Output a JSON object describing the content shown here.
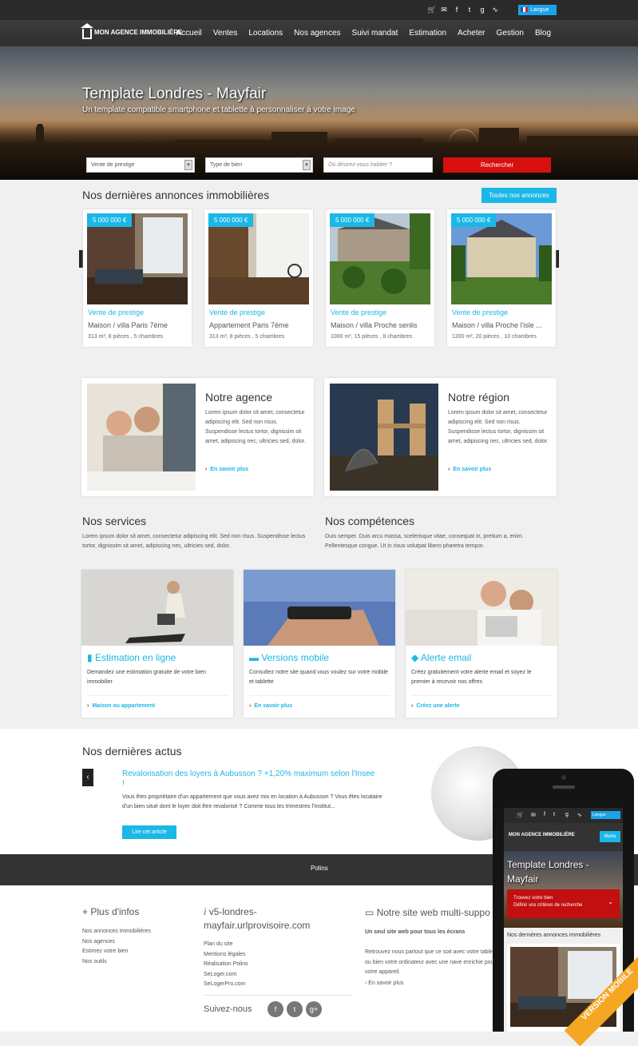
{
  "topbar": {
    "icons": [
      "cart-icon",
      "mail-icon",
      "facebook-icon",
      "twitter-icon",
      "google-plus-icon",
      "rss-icon"
    ],
    "lang_label": "Langue"
  },
  "nav": {
    "logo": "MON AGENCE IMMOBILIÈRE",
    "items": [
      "Accueil",
      "Ventes",
      "Locations",
      "Nos agences",
      "Suivi mandat",
      "Estimation",
      "Acheter",
      "Gestion",
      "Blog"
    ]
  },
  "hero": {
    "title": "Template Londres - Mayfair",
    "subtitle": "Un template compatible smartphone et tablette à personnaliser à votre image",
    "select1": "Vente de prestige",
    "select2": "Type de bien",
    "search_placeholder": "Où désirez-vous habiter ?",
    "search_button": "Rechercher"
  },
  "listings": {
    "title": "Nos dernières annonces immobilières",
    "all_button": "Toutes nos annonces",
    "items": [
      {
        "price": "5 000 000 €",
        "category": "Vente de prestige",
        "name": "Maison / villa Paris 7ème",
        "details": "313 m², 8 pièces , 5 chambres"
      },
      {
        "price": "5 000 000 €",
        "category": "Vente de prestige",
        "name": "Appartement Paris 7ème",
        "details": "313 m², 8 pièces , 5 chambres"
      },
      {
        "price": "5 000 000 €",
        "category": "Vente de prestige",
        "name": "Maison / villa Proche senlis",
        "details": "1000 m², 15 pièces , 8 chambres"
      },
      {
        "price": "5 000 000 €",
        "category": "Vente de prestige",
        "name": "Maison / villa Proche l'isle ...",
        "details": "1200 m², 20 pièces , 10 chambres"
      }
    ]
  },
  "agency": {
    "title": "Notre agence",
    "text": "Lorem ipsum dolor sit amet, consectetur adipiscing elit. Sed non risus. Suspendisse lectus tortor, dignissim sit amet, adipiscing nec, ultricies sed, dolor.",
    "link": "En savoir plus"
  },
  "region": {
    "title": "Notre région",
    "text": "Lorem ipsum dolor sit amet, consectetur adipiscing elit. Sed non risus. Suspendisse lectus tortor, dignissim sit amet, adipiscing nec, ultricies sed, dolor.",
    "link": "En savoir plus"
  },
  "services": {
    "title": "Nos services",
    "text": "Lorem ipsum dolor sit amet, consectetur adipiscing elit. Sed non risus. Suspendisse lectus tortor, dignissim sit amet, adipiscing nec, ultricies sed, dolor."
  },
  "competences": {
    "title": "Nos compétences",
    "text": "Duis semper. Duis arcu massa, scelerisque vitae, consequat in, pretium a, enim. Pellentesque congue. Ut in risus volutpat libero pharetra tempor."
  },
  "cards": [
    {
      "title": "Estimation en ligne",
      "text": "Demandez une estimation gratuite de votre bien immobilier",
      "link": "Maison ou appartement"
    },
    {
      "title": "Versions mobile",
      "text": "Consultez notre site quand vous voulez sur votre mobile et tablette",
      "link": "En savoir plus"
    },
    {
      "title": "Alerte email",
      "text": "Créez gratuitement votre alerte email et soyez le premier à recevoir nos offres",
      "link": "Créez une alerte"
    }
  ],
  "news": {
    "title": "Nos dernières actus",
    "article_title": "Revalorisation des loyers à Aubusson ? +1,20% maximum selon l'Insee !",
    "article_text": "Vous êtes propriétaire d'un appartement que vous avez mis en location à Aubusson ? Vous êtes locataire d'un bien situé dont le loyer doit être revalorisé ? Comme tous les trimestres l'Institut...",
    "read_button": "Lire cet article"
  },
  "footbar": {
    "text": "Polins"
  },
  "footer": {
    "col1_title": "Plus d'infos",
    "col1_links": [
      "Nos annonces immobilières",
      "Nos agences",
      "Estimez votre bien",
      "Nos outils"
    ],
    "col2_title": "v5-londres-mayfair.urlprovisoire.com",
    "col2_links": [
      "Plan du site",
      "Mentions légales",
      "Réalisation Polins",
      "SeLoger.com",
      "SeLogerPro.com"
    ],
    "follow": "Suivez-nous",
    "col3_title": "Notre site web multi-suppo",
    "col3_subtitle": "Un seul site web pour tous les écrans",
    "col3_text": "Retrouvez nous partout que ce soit avec votre tablette ou bien votre ordinateur avec une nave enrichie pour votre appareil.",
    "col3_link": "En savoir plus"
  },
  "phone": {
    "logo": "MON AGENCE IMMOBILIÈRE",
    "menu": "Menu",
    "lang": "Langue",
    "title": "Template Londres - Mayfair",
    "box_title": "Trouvez votre bien",
    "box_sub": "Définir vos critères de recherche",
    "section": "Nos dernières annonces immobilières",
    "band": "VERSION MOBILE"
  }
}
